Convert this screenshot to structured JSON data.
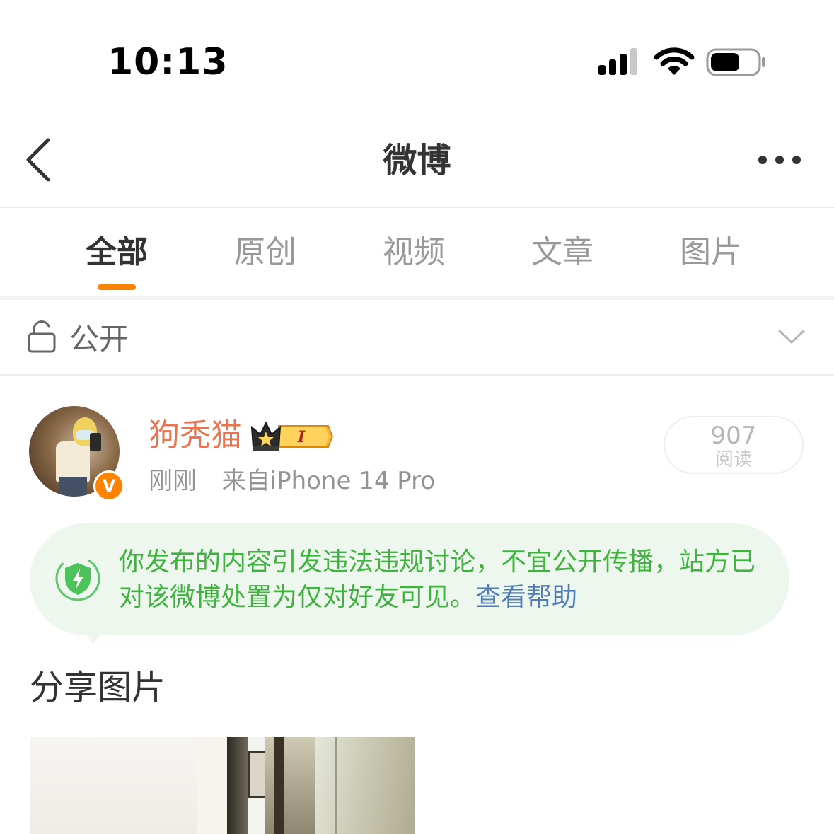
{
  "status_bar": {
    "time": "10:13",
    "icons": [
      "cellular-signal-icon",
      "wifi-icon",
      "battery-icon"
    ]
  },
  "nav": {
    "title": "微博",
    "back_icon": "chevron-left-icon",
    "more_icon": "more-dots-icon"
  },
  "tabs": [
    {
      "label": "全部",
      "active": true
    },
    {
      "label": "原创",
      "active": false
    },
    {
      "label": "视频",
      "active": false
    },
    {
      "label": "文章",
      "active": false
    },
    {
      "label": "图片",
      "active": false
    }
  ],
  "visibility": {
    "label": "公开",
    "icon": "unlock-icon",
    "dropdown_icon": "chevron-down-icon"
  },
  "post": {
    "username": "狗秃猫",
    "verified_badge": "V",
    "time": "刚刚",
    "source": "来自iPhone 14 Pro",
    "read_count": "907",
    "read_label": "阅读",
    "notice": {
      "text": "你发布的内容引发违法违规讨论，不宜公开传播，站方已对该微博处置为仅对好友可见。",
      "link": "查看帮助",
      "icon": "shield-lightning-icon"
    },
    "content": "分享图片"
  },
  "colors": {
    "accent_orange": "#ff8200",
    "username": "#eb7350",
    "notice_green": "#3fb23f",
    "notice_bg": "#eef7ee",
    "link_blue": "#4f7db8"
  }
}
